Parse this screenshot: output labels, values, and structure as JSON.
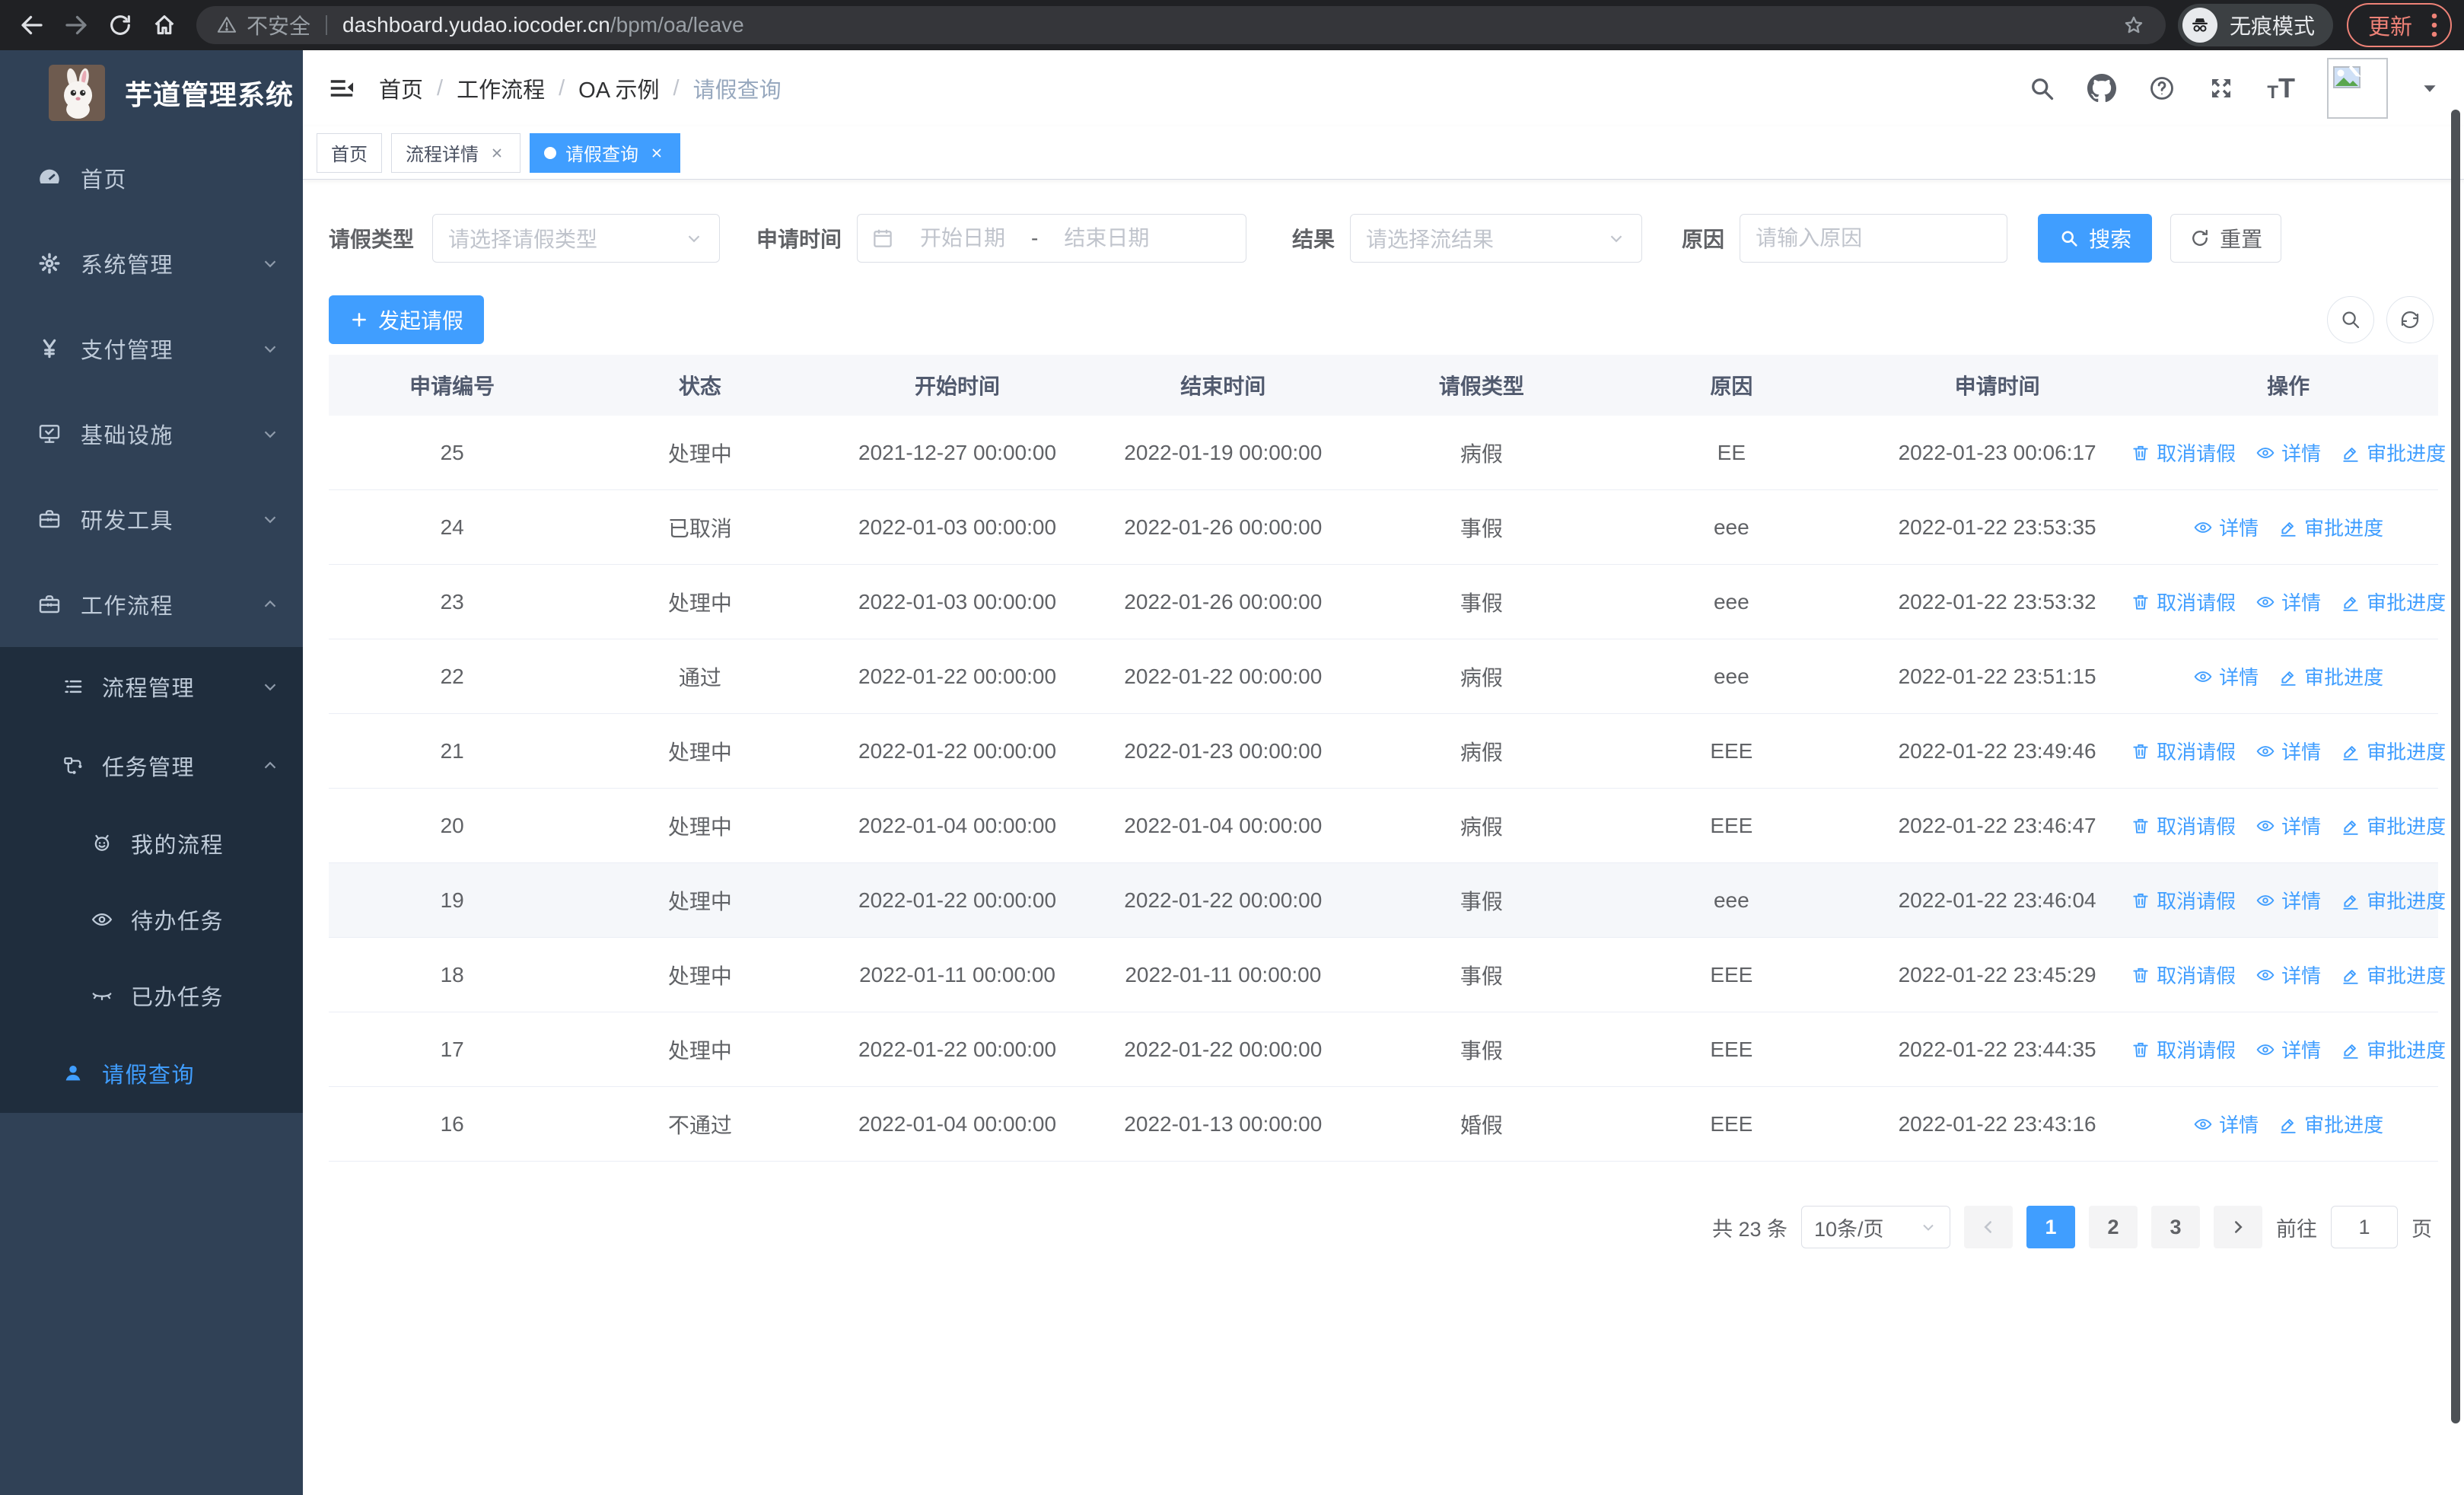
{
  "browser": {
    "security_label": "不安全",
    "url_host": "dashboard.yudao.iocoder.cn",
    "url_path": "/bpm/oa/leave",
    "incognito_label": "无痕模式",
    "update_label": "更新"
  },
  "sidebar": {
    "title": "芋道管理系统",
    "items": [
      {
        "label": "首页",
        "icon": "dashboard-icon"
      },
      {
        "label": "系统管理",
        "icon": "gear-icon",
        "chevron": "down"
      },
      {
        "label": "支付管理",
        "icon": "yen-icon",
        "chevron": "down"
      },
      {
        "label": "基础设施",
        "icon": "monitor-icon",
        "chevron": "down"
      },
      {
        "label": "研发工具",
        "icon": "toolbox-icon",
        "chevron": "down"
      },
      {
        "label": "工作流程",
        "icon": "briefcase-icon",
        "chevron": "up"
      }
    ],
    "submenu": [
      {
        "label": "流程管理",
        "icon": "list-icon",
        "chevron": "down",
        "level": 1
      },
      {
        "label": "任务管理",
        "icon": "workflow-icon",
        "chevron": "up",
        "level": 1
      },
      {
        "label": "我的流程",
        "icon": "robot-icon",
        "level": 2
      },
      {
        "label": "待办任务",
        "icon": "eye-open-icon",
        "level": 2
      },
      {
        "label": "已办任务",
        "icon": "eye-closed-icon",
        "level": 2
      },
      {
        "label": "请假查询",
        "icon": "user-icon",
        "level": 1,
        "active": true
      }
    ]
  },
  "header": {
    "breadcrumb": [
      "首页",
      "工作流程",
      "OA 示例",
      "请假查询"
    ],
    "separator": "/"
  },
  "tabs": [
    {
      "label": "首页",
      "closable": false,
      "active": false
    },
    {
      "label": "流程详情",
      "closable": true,
      "active": false
    },
    {
      "label": "请假查询",
      "closable": true,
      "active": true
    }
  ],
  "filters": {
    "leave_type_label": "请假类型",
    "leave_type_placeholder": "请选择请假类型",
    "apply_time_label": "申请时间",
    "start_placeholder": "开始日期",
    "date_separator": "-",
    "end_placeholder": "结束日期",
    "result_label": "结果",
    "result_placeholder": "请选择流结果",
    "reason_label": "原因",
    "reason_placeholder": "请输入原因",
    "search_label": "搜索",
    "reset_label": "重置"
  },
  "toolbar": {
    "create_label": "发起请假"
  },
  "table": {
    "columns": [
      "申请编号",
      "状态",
      "开始时间",
      "结束时间",
      "请假类型",
      "原因",
      "申请时间",
      "操作"
    ],
    "action_labels": {
      "cancel": "取消请假",
      "detail": "详情",
      "progress": "审批进度"
    },
    "rows": [
      {
        "no": "25",
        "status": "处理中",
        "start": "2021-12-27 00:00:00",
        "end": "2022-01-19 00:00:00",
        "type": "病假",
        "reason": "EE",
        "apply_time": "2022-01-23 00:06:17",
        "actions": [
          "cancel",
          "detail",
          "progress"
        ]
      },
      {
        "no": "24",
        "status": "已取消",
        "start": "2022-01-03 00:00:00",
        "end": "2022-01-26 00:00:00",
        "type": "事假",
        "reason": "eee",
        "apply_time": "2022-01-22 23:53:35",
        "actions": [
          "detail",
          "progress"
        ]
      },
      {
        "no": "23",
        "status": "处理中",
        "start": "2022-01-03 00:00:00",
        "end": "2022-01-26 00:00:00",
        "type": "事假",
        "reason": "eee",
        "apply_time": "2022-01-22 23:53:32",
        "actions": [
          "cancel",
          "detail",
          "progress"
        ]
      },
      {
        "no": "22",
        "status": "通过",
        "start": "2022-01-22 00:00:00",
        "end": "2022-01-22 00:00:00",
        "type": "病假",
        "reason": "eee",
        "apply_time": "2022-01-22 23:51:15",
        "actions": [
          "detail",
          "progress"
        ]
      },
      {
        "no": "21",
        "status": "处理中",
        "start": "2022-01-22 00:00:00",
        "end": "2022-01-23 00:00:00",
        "type": "病假",
        "reason": "EEE",
        "apply_time": "2022-01-22 23:49:46",
        "actions": [
          "cancel",
          "detail",
          "progress"
        ]
      },
      {
        "no": "20",
        "status": "处理中",
        "start": "2022-01-04 00:00:00",
        "end": "2022-01-04 00:00:00",
        "type": "病假",
        "reason": "EEE",
        "apply_time": "2022-01-22 23:46:47",
        "actions": [
          "cancel",
          "detail",
          "progress"
        ]
      },
      {
        "no": "19",
        "status": "处理中",
        "start": "2022-01-22 00:00:00",
        "end": "2022-01-22 00:00:00",
        "type": "事假",
        "reason": "eee",
        "apply_time": "2022-01-22 23:46:04",
        "actions": [
          "cancel",
          "detail",
          "progress"
        ],
        "highlighted": true
      },
      {
        "no": "18",
        "status": "处理中",
        "start": "2022-01-11 00:00:00",
        "end": "2022-01-11 00:00:00",
        "type": "事假",
        "reason": "EEE",
        "apply_time": "2022-01-22 23:45:29",
        "actions": [
          "cancel",
          "detail",
          "progress"
        ]
      },
      {
        "no": "17",
        "status": "处理中",
        "start": "2022-01-22 00:00:00",
        "end": "2022-01-22 00:00:00",
        "type": "事假",
        "reason": "EEE",
        "apply_time": "2022-01-22 23:44:35",
        "actions": [
          "cancel",
          "detail",
          "progress"
        ]
      },
      {
        "no": "16",
        "status": "不通过",
        "start": "2022-01-04 00:00:00",
        "end": "2022-01-13 00:00:00",
        "type": "婚假",
        "reason": "EEE",
        "apply_time": "2022-01-22 23:43:16",
        "actions": [
          "detail",
          "progress"
        ]
      }
    ]
  },
  "pagination": {
    "total_text": "共 23 条",
    "page_size": "10条/页",
    "pages": [
      "1",
      "2",
      "3"
    ],
    "active_page": "1",
    "goto_label": "前往",
    "goto_value": "1",
    "page_unit": "页"
  },
  "colors": {
    "primary": "#409eff",
    "sidebar_bg": "#304156",
    "submenu_bg": "#1f2d3d",
    "chrome_bg": "#202124",
    "update_accent": "#ee8277",
    "table_border": "#ebeef5",
    "header_bg": "#f6f7fa"
  },
  "icons": [
    "back-icon",
    "forward-icon",
    "reload-icon",
    "home-icon",
    "warning-icon",
    "star-icon",
    "incognito-icon",
    "kebab-icon",
    "hamburger-icon",
    "search-icon",
    "github-icon",
    "help-icon",
    "fullscreen-icon",
    "font-size-icon",
    "broken-avatar-icon",
    "caret-down-icon",
    "chevron-down-icon",
    "calendar-icon",
    "plus-icon",
    "refresh-icon",
    "trash-icon",
    "eye-icon",
    "pen-icon",
    "chevron-left-icon",
    "chevron-right-icon"
  ]
}
